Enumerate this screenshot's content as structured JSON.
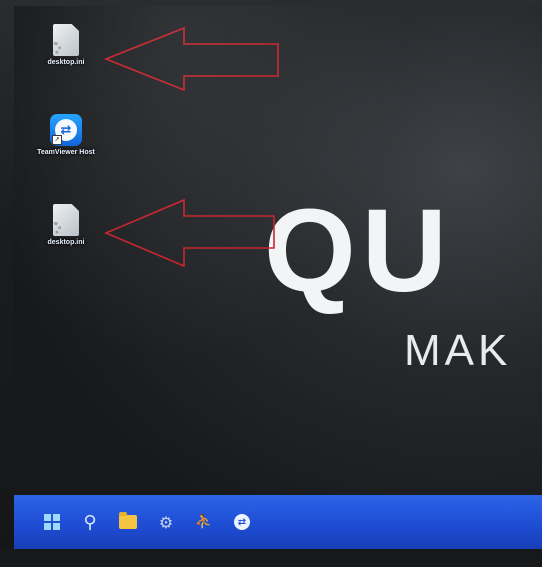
{
  "desktop": {
    "icons": [
      {
        "label": "desktop.ini",
        "icon": "ini-file-icon"
      },
      {
        "label": "TeamViewer Host",
        "icon": "teamviewer-icon"
      },
      {
        "label": "desktop.ini",
        "icon": "ini-file-icon"
      }
    ],
    "annotations": [
      {
        "shape": "red-outline-left-arrow",
        "color": "#c8202a"
      },
      {
        "shape": "red-outline-left-arrow",
        "color": "#c8202a"
      }
    ]
  },
  "wallpaper": {
    "brand_word": "QU",
    "brand_sub": "MAK"
  },
  "taskbar": {
    "items": [
      {
        "icon": "windows-start-icon"
      },
      {
        "icon": "search-icon"
      },
      {
        "icon": "file-explorer-folder-icon"
      },
      {
        "icon": "settings-gear-icon"
      },
      {
        "icon": "person-icon"
      },
      {
        "icon": "teamviewer-icon"
      }
    ],
    "accent_color": "#1f4fd6"
  }
}
